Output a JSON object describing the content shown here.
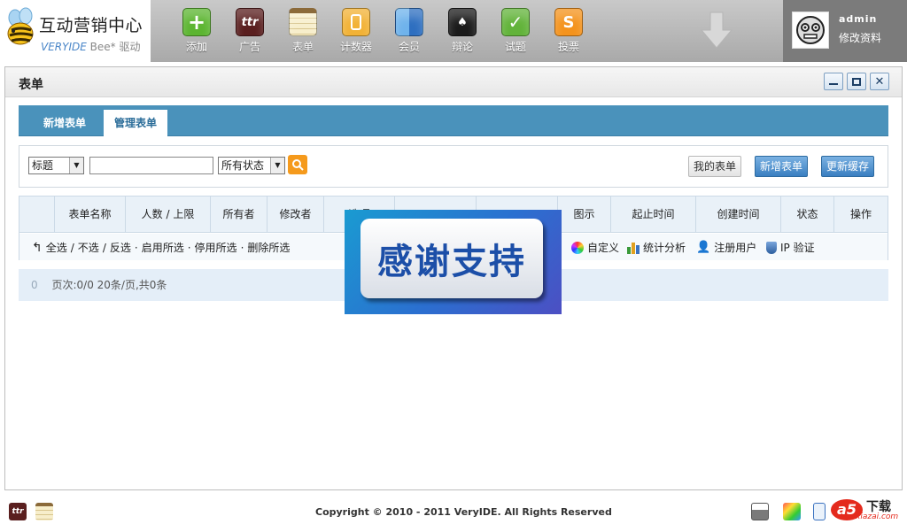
{
  "logo": {
    "title": "互动营销中心",
    "sub_brand": "VERYIDE",
    "sub_bee": "Bee*",
    "sub_drive": "驱动"
  },
  "nav": [
    {
      "label": "添加",
      "icon": "plus-icon",
      "color": "#5cb531",
      "glyph": "+"
    },
    {
      "label": "广告",
      "icon": "ttr-icon",
      "color": "#5a1f1f",
      "glyph": "ttr"
    },
    {
      "label": "表单",
      "icon": "notepad-icon",
      "color": "#e8d9a6",
      "glyph": ""
    },
    {
      "label": "计数器",
      "icon": "counter-icon",
      "color": "#f2b236",
      "glyph": ""
    },
    {
      "label": "会员",
      "icon": "finder-icon",
      "color": "#3c7bc7",
      "glyph": ""
    },
    {
      "label": "辩论",
      "icon": "cards-icon",
      "color": "#1b1b1b",
      "glyph": "♠"
    },
    {
      "label": "试题",
      "icon": "check-icon",
      "color": "#62b33a",
      "glyph": "✓"
    },
    {
      "label": "投票",
      "icon": "s-icon",
      "color": "#f4931d",
      "glyph": "S"
    }
  ],
  "user": {
    "name": "admin",
    "edit_label": "修改资料"
  },
  "panel": {
    "title": "表单"
  },
  "tabs": [
    {
      "label": "新增表单"
    },
    {
      "label": "管理表单"
    }
  ],
  "search": {
    "field_select": "标题",
    "status_select": "所有状态",
    "buttons": {
      "my_forms": "我的表单",
      "new_form": "新增表单",
      "refresh_cache": "更新缓存"
    }
  },
  "table": {
    "columns": [
      "表单名称",
      "人数 / 上限",
      "所有者",
      "修改者",
      "选项",
      "",
      "",
      "图示",
      "起止时间",
      "创建时间",
      "状态",
      "操作"
    ],
    "actions": [
      "全选",
      "不选",
      "反选",
      "启用所选",
      "停用所选",
      "删除所选"
    ],
    "features": [
      {
        "label": "自定义",
        "icon": "color-wheel-icon"
      },
      {
        "label": "统计分析",
        "icon": "bar-chart-icon"
      },
      {
        "label": "注册用户",
        "icon": "user-icon"
      },
      {
        "label": "IP 验证",
        "icon": "shield-icon"
      }
    ]
  },
  "pager": {
    "count": "0",
    "text": "页次:0/0 20条/页,共0条"
  },
  "overlay": {
    "text": "感谢支持"
  },
  "footer": {
    "copyright": "Copyright © 2010 - 2011 VeryIDE. All Rights Reserved",
    "watermark": "下载",
    "watermark_site": "xiazai.com"
  }
}
